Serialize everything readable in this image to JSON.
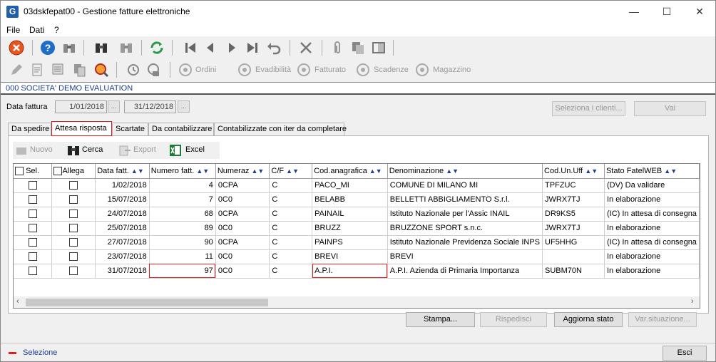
{
  "window": {
    "title": "03dskfepat00 - Gestione fatture elettroniche",
    "app_icon": "G"
  },
  "menu": [
    "File",
    "Dati",
    "?"
  ],
  "toolbar2": {
    "ordini": "Ordini",
    "evadibilita": "Evadibilità",
    "fatturato": "Fatturato",
    "scadenze": "Scadenze",
    "magazzino": "Magazzino"
  },
  "company": "000 SOCIETA' DEMO EVALUATION",
  "filter": {
    "label": "Data fattura",
    "from": "1/01/2018",
    "to": "31/12/2018",
    "dots": "...",
    "select_clients": "Seleziona i clienti...",
    "go": "Vai"
  },
  "tabs": [
    "Da spedire",
    "Attesa risposta",
    "Scartate",
    "Da contabilizzare",
    "Contabilizzate con iter da completare"
  ],
  "panel_tools": {
    "nuovo": "Nuovo",
    "cerca": "Cerca",
    "export": "Export",
    "excel": "Excel"
  },
  "columns": [
    "Sel.",
    "Allega",
    "Data fatt.",
    "Numero fatt.",
    "Numeraz",
    "C/F",
    "Cod.anagrafica",
    "Denominazione",
    "Cod.Un.Uff",
    "Stato FatelWEB"
  ],
  "rows": [
    [
      "1/02/2018",
      "4",
      "0CPA",
      "C",
      "PACO_MI",
      "COMUNE DI MILANO MI",
      "TPFZUC",
      "(DV) Da validare"
    ],
    [
      "15/07/2018",
      "7",
      "0C0",
      "C",
      "BELABB",
      "BELLETTI ABBIGLIAMENTO S.r.l.",
      "JWRX7TJ",
      "In elaborazione"
    ],
    [
      "24/07/2018",
      "68",
      "0CPA",
      "C",
      "PAINAIL",
      "Istituto Nazionale per l'Assic INAIL",
      "DR9KS5",
      "(IC) In attesa di consegna"
    ],
    [
      "25/07/2018",
      "89",
      "0C0",
      "C",
      "BRUZZ",
      "BRUZZONE SPORT s.n.c.",
      "JWRX7TJ",
      "In elaborazione"
    ],
    [
      "27/07/2018",
      "90",
      "0CPA",
      "C",
      "PAINPS",
      "Istituto Nazionale Previdenza Sociale INPS",
      "UF5HHG",
      "(IC) In attesa di consegna"
    ],
    [
      "23/07/2018",
      "11",
      "0C0",
      "C",
      "BREVI",
      "BREVI",
      "",
      "In elaborazione"
    ],
    [
      "31/07/2018",
      "97",
      "0C0",
      "C",
      "A.P.I.",
      "A.P.I. Azienda di Primaria Importanza",
      "SUBM70N",
      "In elaborazione"
    ]
  ],
  "buttons": {
    "stampa": "Stampa...",
    "rispedisci": "Rispedisci",
    "aggiorna": "Aggiorna stato",
    "varsit": "Var.situazione...",
    "esci": "Esci"
  },
  "status": "Selezione"
}
